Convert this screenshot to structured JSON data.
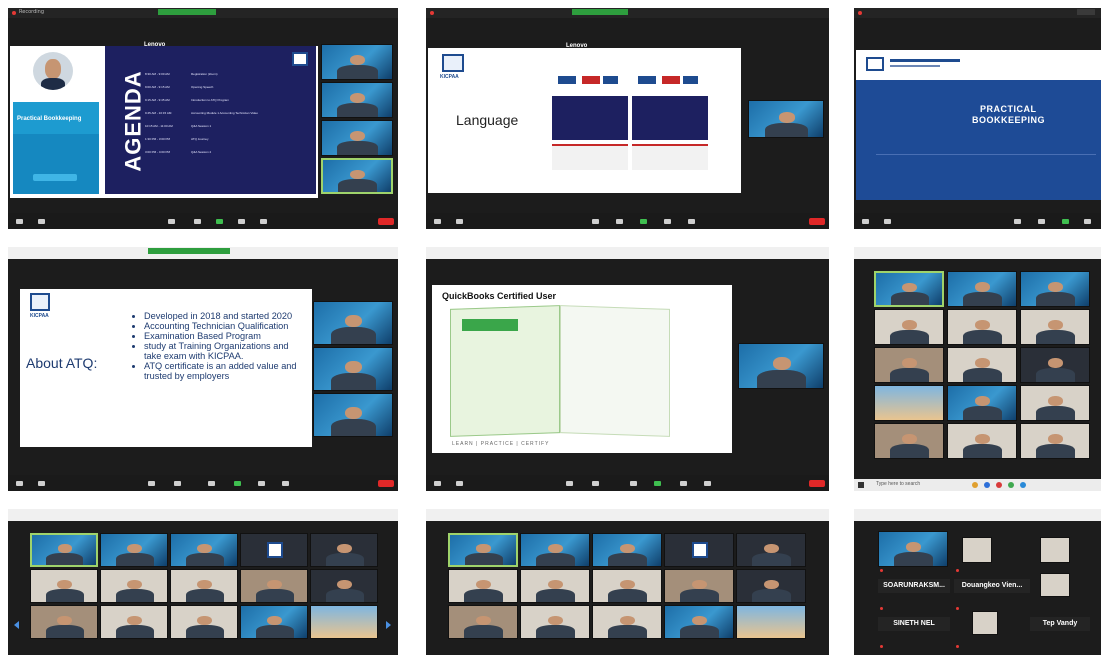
{
  "panel1": {
    "bar_label": "Recording",
    "bookkeeping_tag": "Practical Bookkeeping",
    "agenda_word": "AGENDA",
    "brand": "Lenovo",
    "items": [
      {
        "time": "8:30 AM - 9:00 AM",
        "title": "Registration (Zoom)"
      },
      {
        "time": "9:00 AM - 9:15 AM",
        "title": "Opening Speech"
      },
      {
        "time": "9:15 AM - 9:45 AM",
        "title": "Introduction to ATQ Program"
      },
      {
        "time": "9:45 AM - 10:15 AM",
        "title": "Accounting Module 1 Accounting Technician Video"
      },
      {
        "time": "10:15 AM - 11:00 AM",
        "title": "Q&A Session 1"
      },
      {
        "time": "1:30 PM - 3:00 PM",
        "title": "ATQ Journey"
      },
      {
        "time": "3:00 PM - 4:00 PM",
        "title": "Q&A Session 2"
      }
    ]
  },
  "panel2": {
    "brand": "Lenovo",
    "language_title": "Language",
    "logo_text": "KICPAA"
  },
  "panel3": {
    "title_line1": "PRACTICAL",
    "title_line2": "BOOKKEEPING"
  },
  "panel4": {
    "logo_text": "KICPAA",
    "heading": "About ATQ:",
    "bullets": [
      "Developed in 2018 and started 2020",
      "Accounting Technician Qualification",
      "Examination Based Program",
      "study at Training Organizations and take exam with KICPAA.",
      "ATQ certificate is an added value and trusted by employers"
    ]
  },
  "panel5": {
    "title": "QuickBooks Certified User",
    "footer_text": "LEARN | PRACTICE | CERTIFY"
  },
  "panel6": {
    "taskbar_search": "Type here to search"
  },
  "panel9": {
    "names": [
      "SOARUNRAKSM...",
      "Douangkeo Vien...",
      "SINETH NEL",
      "Tep Vandy"
    ]
  },
  "colors": {
    "zoom_bg": "#1c1c1c",
    "zoom_green": "#2e9e3e",
    "end_red": "#e02828",
    "agenda_navy": "#1d2060",
    "kicpaa_blue": "#1e4b8f"
  }
}
